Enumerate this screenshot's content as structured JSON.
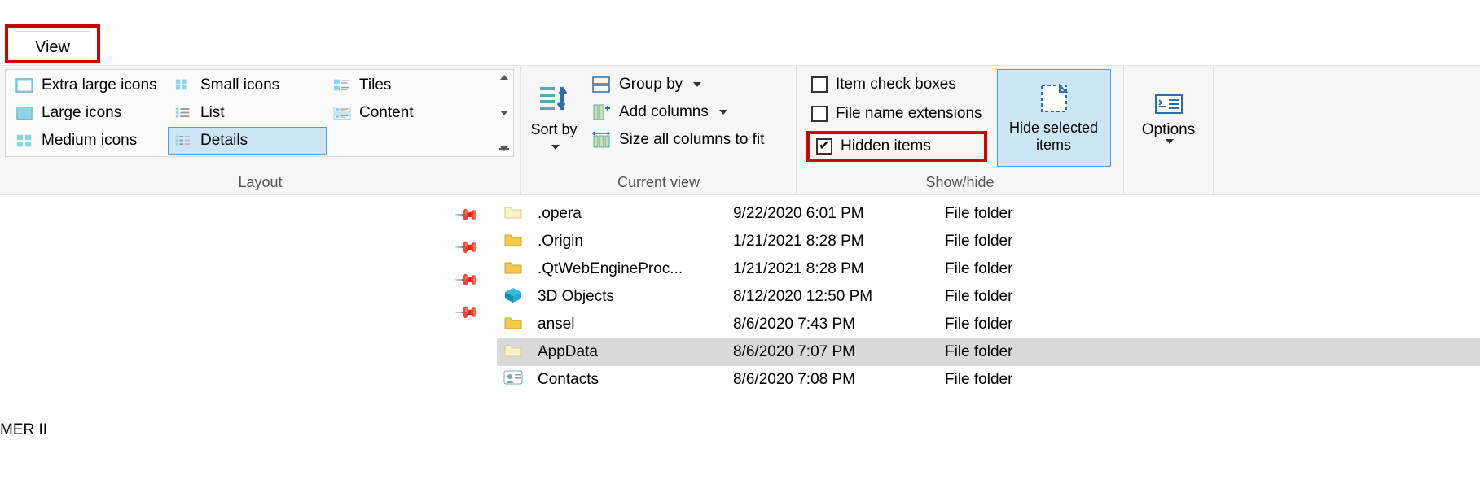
{
  "tab": {
    "view": "View"
  },
  "ribbon": {
    "layout": {
      "label": "Layout",
      "items": [
        "Extra large icons",
        "Small icons",
        "Tiles",
        "Large icons",
        "List",
        "Content",
        "Medium icons",
        "Details"
      ],
      "selected": "Details"
    },
    "current_view": {
      "label": "Current view",
      "sort_by": "Sort by",
      "group_by": "Group by",
      "add_columns": "Add columns",
      "size_all": "Size all columns to fit"
    },
    "show_hide": {
      "label": "Show/hide",
      "item_check_boxes": {
        "label": "Item check boxes",
        "checked": false
      },
      "file_name_extensions": {
        "label": "File name extensions",
        "checked": false
      },
      "hidden_items": {
        "label": "Hidden items",
        "checked": true
      },
      "hide_selected": "Hide selected items"
    },
    "options": "Options"
  },
  "drive_label_fragment": "MER II",
  "files": [
    {
      "name": ".opera",
      "date": "9/22/2020 6:01 PM",
      "type": "File folder",
      "icon": "pale"
    },
    {
      "name": ".Origin",
      "date": "1/21/2021 8:28 PM",
      "type": "File folder",
      "icon": "yellow"
    },
    {
      "name": ".QtWebEngineProc...",
      "date": "1/21/2021 8:28 PM",
      "type": "File folder",
      "icon": "yellow"
    },
    {
      "name": "3D Objects",
      "date": "8/12/2020 12:50 PM",
      "type": "File folder",
      "icon": "3d"
    },
    {
      "name": "ansel",
      "date": "8/6/2020 7:43 PM",
      "type": "File folder",
      "icon": "yellow"
    },
    {
      "name": "AppData",
      "date": "8/6/2020 7:07 PM",
      "type": "File folder",
      "icon": "pale",
      "selected": true
    },
    {
      "name": "Contacts",
      "date": "8/6/2020 7:08 PM",
      "type": "File folder",
      "icon": "contacts"
    }
  ]
}
